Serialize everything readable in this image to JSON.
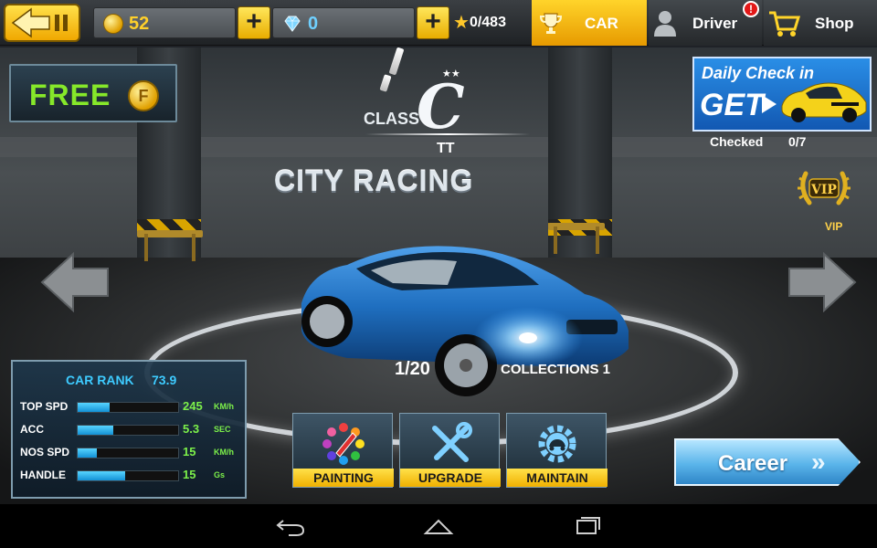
{
  "topbar": {
    "coins": "52",
    "gems": "0",
    "stars": "0/483",
    "tabs": {
      "car": "CAR",
      "driver": "Driver",
      "shop": "Shop"
    }
  },
  "free": {
    "label": "FREE",
    "coin_glyph": "F"
  },
  "car": {
    "class_prefix": "CLASS",
    "class_letter": "C",
    "class_stars": "★★",
    "model": "TT",
    "title": "CITY RACING",
    "index": "1/20",
    "collections": "COLLECTIONS 1",
    "color": "#1f6fc0"
  },
  "daily": {
    "line1": "Daily Check in",
    "line2": "GET",
    "checked_label": "Checked",
    "checked_value": "0/7"
  },
  "vip": {
    "badge": "VIP",
    "label": "VIP"
  },
  "stats": {
    "rank_label": "CAR RANK",
    "rank_value": "73.9",
    "rows": [
      {
        "name": "TOP SPD",
        "value": "245",
        "unit": "KM/h",
        "fill": 0.32
      },
      {
        "name": "ACC",
        "value": "5.3",
        "unit": "SEC",
        "fill": 0.35
      },
      {
        "name": "NOS SPD",
        "value": "15",
        "unit": "KM/h",
        "fill": 0.19
      },
      {
        "name": "HANDLE",
        "value": "15",
        "unit": "Gs",
        "fill": 0.47
      }
    ]
  },
  "actions": {
    "painting": "PAINTING",
    "upgrade": "UPGRADE",
    "maintain": "MAINTAIN"
  },
  "career": {
    "label": "Career",
    "chevron": "»"
  },
  "colors": {
    "accent_yellow": "#f2b800",
    "accent_blue": "#3ecbff",
    "stat_green": "#7cf04a",
    "free_green": "#86e82a"
  }
}
